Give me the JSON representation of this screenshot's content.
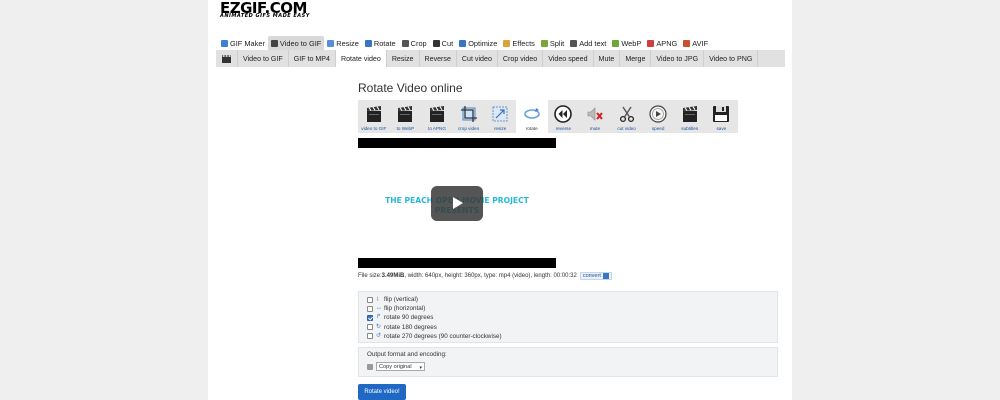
{
  "logo": {
    "text": "EZGIF.COM",
    "tagline": "ANIMATED GIFS MADE EASY"
  },
  "top_nav": [
    {
      "label": "GIF Maker",
      "icon": "gif-maker-icon",
      "color": "#3d7fd6"
    },
    {
      "label": "Video to GIF",
      "icon": "film-icon",
      "color": "#444444",
      "active": true
    },
    {
      "label": "Resize",
      "icon": "resize-icon",
      "color": "#5b8ed6"
    },
    {
      "label": "Rotate",
      "icon": "rotate-icon",
      "color": "#3a75c4"
    },
    {
      "label": "Crop",
      "icon": "crop-icon",
      "color": "#555555"
    },
    {
      "label": "Cut",
      "icon": "cut-icon",
      "color": "#333333"
    },
    {
      "label": "Optimize",
      "icon": "optimize-icon",
      "color": "#3a75c4"
    },
    {
      "label": "Effects",
      "icon": "effects-icon",
      "color": "#d9a23a"
    },
    {
      "label": "Split",
      "icon": "split-icon",
      "color": "#7aa63c"
    },
    {
      "label": "Add text",
      "icon": "add-text-icon",
      "color": "#555555"
    },
    {
      "label": "WebP",
      "icon": "webp-icon",
      "color": "#6aa838"
    },
    {
      "label": "APNG",
      "icon": "apng-icon",
      "color": "#d33c3c"
    },
    {
      "label": "AVIF",
      "icon": "avif-icon",
      "color": "#c9502e"
    }
  ],
  "sub_nav": [
    "Video to GIF",
    "GIF to MP4",
    "Rotate video",
    "Resize",
    "Reverse",
    "Cut video",
    "Crop video",
    "Video speed",
    "Mute",
    "Merge",
    "Video to JPG",
    "Video to PNG"
  ],
  "sub_nav_active": "Rotate video",
  "page_title": "Rotate Video online",
  "toolbar": [
    {
      "label": "video to GIF",
      "icon": "clapperboard-icon"
    },
    {
      "label": "to WebP",
      "icon": "clapperboard-icon"
    },
    {
      "label": "to APNG",
      "icon": "clapperboard-icon"
    },
    {
      "label": "crop video",
      "icon": "crop-icon"
    },
    {
      "label": "resize",
      "icon": "resize-icon"
    },
    {
      "label": "rotate",
      "icon": "rotate-icon",
      "active": true
    },
    {
      "label": "reverse",
      "icon": "rewind-icon"
    },
    {
      "label": "mute",
      "icon": "mute-icon"
    },
    {
      "label": "cut video",
      "icon": "scissors-icon"
    },
    {
      "label": "speed",
      "icon": "speedometer-icon"
    },
    {
      "label": "subtitles",
      "icon": "clapperboard-icon"
    },
    {
      "label": "save",
      "icon": "floppy-disk-icon"
    }
  ],
  "video": {
    "overlay_text_line1": "THE PEACH OPEN MOVIE PROJECT",
    "overlay_text_line2": "PRESENTS"
  },
  "file_info": {
    "size_label": "File size: ",
    "size": "3.49MiB",
    "rest": ", width: 640px, height: 360px, type: mp4 (video), length: 00:00:32",
    "convert_label": "convert"
  },
  "options": [
    {
      "label": "flip (vertical)",
      "checked": false
    },
    {
      "label": "flip (horizontal)",
      "checked": false
    },
    {
      "label": "rotate 90 degrees",
      "checked": true
    },
    {
      "label": "rotate 180 degrees",
      "checked": false
    },
    {
      "label": "rotate 270 degrees (90 counter-clockwise)",
      "checked": false
    }
  ],
  "output": {
    "label": "Output format and encoding:",
    "selected": "Copy original"
  },
  "submit_label": "Rotate video!"
}
